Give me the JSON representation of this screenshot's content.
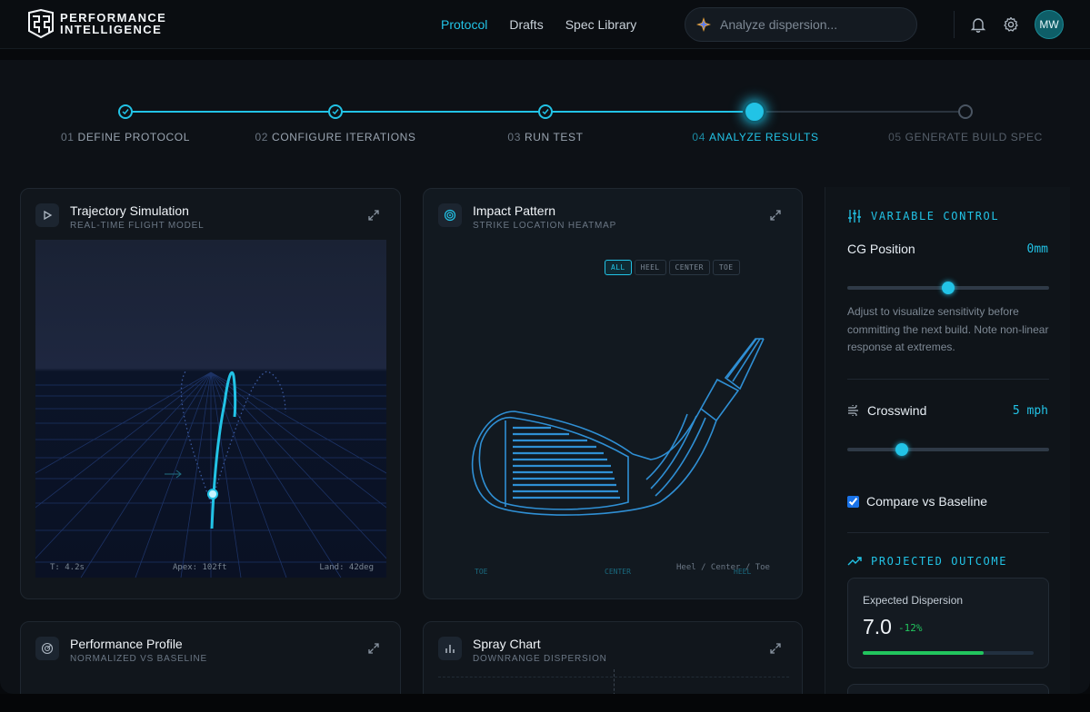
{
  "brand": {
    "line1": "PERFORMANCE",
    "line2": "INTELLIGENCE"
  },
  "nav": {
    "items": [
      {
        "label": "Protocol",
        "active": true
      },
      {
        "label": "Drafts",
        "active": false
      },
      {
        "label": "Spec Library",
        "active": false
      }
    ]
  },
  "search": {
    "placeholder": "Analyze dispersion..."
  },
  "user": {
    "initials": "MW"
  },
  "steps": [
    {
      "num": "01",
      "label": "DEFINE PROTOCOL",
      "state": "done"
    },
    {
      "num": "02",
      "label": "CONFIGURE ITERATIONS",
      "state": "done"
    },
    {
      "num": "03",
      "label": "RUN TEST",
      "state": "done"
    },
    {
      "num": "04",
      "label": "ANALYZE RESULTS",
      "state": "active"
    },
    {
      "num": "05",
      "label": "GENERATE BUILD SPEC",
      "state": "pending"
    }
  ],
  "trajectory": {
    "title": "Trajectory Simulation",
    "subtitle": "REAL-TIME FLIGHT MODEL",
    "footer": {
      "time": "T: 4.2s",
      "apex": "Apex: 102ft",
      "land": "Land: 42deg"
    }
  },
  "impact": {
    "title": "Impact Pattern",
    "subtitle": "STRIKE LOCATION HEATMAP",
    "filters": [
      "ALL",
      "HEEL",
      "CENTER",
      "TOE"
    ],
    "active_filter": "ALL",
    "axis": {
      "toe": "TOE",
      "center": "CENTER",
      "heel": "HEEL"
    },
    "legend": "Heel / Center / Toe"
  },
  "profile": {
    "title": "Performance Profile",
    "subtitle": "NORMALIZED VS BASELINE"
  },
  "spray": {
    "title": "Spray Chart",
    "subtitle": "DOWNRANGE DISPERSION"
  },
  "variable_control": {
    "title": "VARIABLE CONTROL",
    "cg": {
      "label": "CG Position",
      "value": "0mm",
      "level": 0.5
    },
    "note": "Adjust to visualize sensitivity before committing the next build. Note non-linear response at extremes.",
    "crosswind": {
      "label": "Crosswind",
      "value": "5 mph",
      "level": 0.27
    },
    "compare": {
      "label": "Compare vs Baseline",
      "checked": true
    }
  },
  "outcome": {
    "title": "PROJECTED OUTCOME",
    "metric": {
      "label": "Expected Dispersion",
      "value": "7.0",
      "delta": "-12%",
      "progress": 0.71
    }
  },
  "colors": {
    "accent": "#22c3e6",
    "positive": "#22c55e"
  }
}
